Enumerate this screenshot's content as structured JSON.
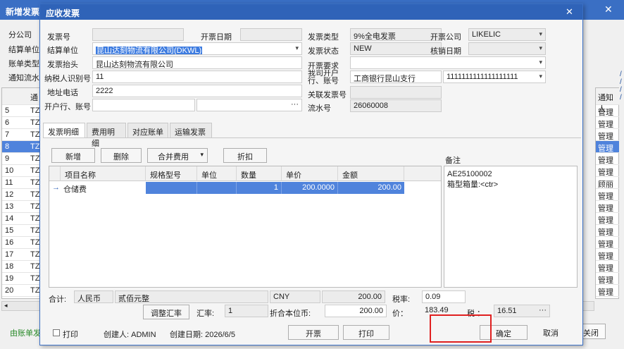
{
  "bg": {
    "title": "新增发票",
    "labels": [
      "分公司",
      "结算单位",
      "账单类型",
      "通知流水"
    ],
    "header_code": "通",
    "rows": [
      {
        "n": "5",
        "t": "TZ"
      },
      {
        "n": "6",
        "t": "TZ"
      },
      {
        "n": "7",
        "t": "TZ"
      },
      {
        "n": "8",
        "t": "TZ"
      },
      {
        "n": "9",
        "t": "TZ"
      },
      {
        "n": "10",
        "t": "TZ"
      },
      {
        "n": "11",
        "t": "TZ"
      },
      {
        "n": "12",
        "t": "TZ"
      },
      {
        "n": "13",
        "t": "TZ"
      },
      {
        "n": "14",
        "t": "TZ"
      },
      {
        "n": "15",
        "t": "TZ"
      },
      {
        "n": "16",
        "t": "TZ"
      },
      {
        "n": "17",
        "t": "TZ"
      },
      {
        "n": "18",
        "t": "TZ"
      },
      {
        "n": "19",
        "t": "TZ"
      },
      {
        "n": "20",
        "t": "TZ"
      }
    ],
    "right_header": "通知人",
    "right_rows": [
      "管理",
      "管理",
      "管理",
      "管理",
      "管理",
      "管理",
      "顾丽",
      "管理",
      "管理",
      "管理",
      "管理",
      "管理",
      "管理",
      "管理",
      "管理",
      "管理"
    ],
    "green_text": "由账单发",
    "close_btn": "关闭"
  },
  "dialog": {
    "title": "应收发票",
    "labels": {
      "invoice_no": "发票号",
      "invoice_date": "开票日期",
      "settle_unit": "结算单位",
      "invoice_head": "发票抬头",
      "tax_id": "纳税人识别号",
      "address_phone": "地址电话",
      "bank_account": "开户行、账号",
      "invoice_type": "发票类型",
      "invoice_status": "发票状态",
      "invoice_req": "开票要求",
      "our_bank": "我司开户行、账号",
      "related_no": "关联发票号",
      "serial_no": "流水号",
      "issuing_company": "开票公司",
      "writeoff_date": "核销日期"
    },
    "values": {
      "invoice_no": "",
      "invoice_date": "",
      "settle_unit": "昆山达刻物流有限公司(DKWL)",
      "invoice_head": "昆山达刻物流有限公司",
      "tax_id": "11",
      "address_phone": "2222",
      "bank_name": "",
      "bank_account": "",
      "invoice_type": "9%全电发票",
      "invoice_status": "NEW",
      "invoice_req": "",
      "our_bank": "工商银行昆山支行",
      "our_account": "1111111111111111111",
      "related_no": "",
      "serial_no": "26060008",
      "issuing_company": "LIKELIC",
      "writeoff_date": ""
    },
    "tabs": [
      "发票明细",
      "费用明细",
      "对应账单",
      "运输发票"
    ],
    "toolbar": {
      "add": "新增",
      "delete": "删除",
      "merge": "合并费用",
      "discount": "折扣"
    },
    "grid": {
      "headers": [
        "项目名称",
        "规格型号",
        "单位",
        "数量",
        "单价",
        "金额"
      ],
      "rows": [
        {
          "marker": "→",
          "name": "仓储费",
          "spec": "",
          "unit": "",
          "qty": "1",
          "price": "200.0000",
          "amount": "200.00"
        }
      ]
    },
    "memo": {
      "label": "备注",
      "lines": [
        "AE25100002",
        "箱型箱量:<ctr>"
      ]
    },
    "totals": {
      "total_label": "合计:",
      "currency_name": "人民币",
      "amount_words": "贰佰元整",
      "currency": "CNY",
      "amount": "200.00",
      "tax_rate_label": "税率:",
      "tax_rate": "0.09",
      "adjust_btn": "调整汇率",
      "fx_label": "汇率:",
      "fx": "1",
      "local_label": "折合本位币:",
      "local_amount": "200.00",
      "price_label": "价：",
      "price": "183.49",
      "tax_label": "税 ：",
      "tax": "16.51"
    },
    "footer": {
      "print_check": "打印",
      "creator": "创建人: ADMIN",
      "created": "创建日期: 2026/6/5",
      "invoice_btn": "开票",
      "print_btn": "打印",
      "ok_btn": "确定",
      "cancel_btn": "取消"
    }
  }
}
